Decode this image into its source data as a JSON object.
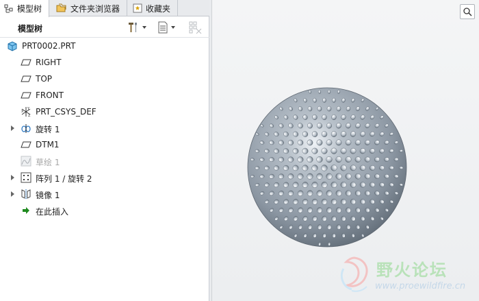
{
  "tabs": [
    {
      "label": "模型树",
      "icon": "model-tree-icon",
      "active": true
    },
    {
      "label": "文件夹浏览器",
      "icon": "folder-browser-icon",
      "active": false
    },
    {
      "label": "收藏夹",
      "icon": "favorites-icon",
      "active": false
    }
  ],
  "tree_header": {
    "title": "模型树",
    "settings_icon": "tools-icon",
    "show_icon": "list-settings-icon",
    "filter_icon": "tree-filter-icon"
  },
  "tree": {
    "root": {
      "label": "PRT0002.PRT",
      "icon": "part-icon"
    },
    "items": [
      {
        "label": "RIGHT",
        "icon": "datum-plane-icon",
        "expandable": false
      },
      {
        "label": "TOP",
        "icon": "datum-plane-icon",
        "expandable": false
      },
      {
        "label": "FRONT",
        "icon": "datum-plane-icon",
        "expandable": false
      },
      {
        "label": "PRT_CSYS_DEF",
        "icon": "coordinate-system-icon",
        "expandable": false
      },
      {
        "label": "旋转 1",
        "icon": "revolve-icon",
        "expandable": true
      },
      {
        "label": "DTM1",
        "icon": "datum-plane-icon",
        "expandable": false
      },
      {
        "label": "草绘 1",
        "icon": "sketch-icon",
        "expandable": false,
        "dimmed": true
      },
      {
        "label": "阵列 1 / 旋转 2",
        "icon": "pattern-icon",
        "expandable": true
      },
      {
        "label": "镜像 1",
        "icon": "mirror-icon",
        "expandable": true
      },
      {
        "label": "在此插入",
        "icon": "insert-here-arrow-icon",
        "expandable": false
      }
    ]
  },
  "viewport": {
    "search_icon": "zoom-search-icon"
  },
  "watermark": {
    "text": "野火论坛",
    "url": "www.proewildfire.cn"
  },
  "colors": {
    "accent_blue": "#2f7bc4",
    "insert_arrow_green": "#1f8a1f",
    "sphere": "#8c97a3"
  }
}
